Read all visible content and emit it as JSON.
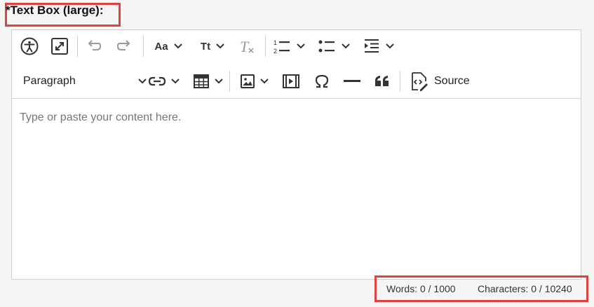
{
  "field": {
    "label": "*Text Box (large):"
  },
  "toolbar": {
    "row1": [
      {
        "name": "accessibility-icon"
      },
      {
        "name": "fullscreen-icon"
      },
      {
        "name": "undo-icon"
      },
      {
        "name": "redo-icon"
      },
      {
        "name": "font-family-icon",
        "label": "Aa"
      },
      {
        "name": "font-size-icon",
        "label": "Tt"
      },
      {
        "name": "remove-format-icon",
        "label": "T"
      },
      {
        "name": "numbered-list-icon"
      },
      {
        "name": "bulleted-list-icon"
      },
      {
        "name": "indent-icon"
      }
    ],
    "paragraph_label": "Paragraph",
    "source_label": "Source"
  },
  "editor": {
    "placeholder": "Type or paste your content here."
  },
  "counters": {
    "words": "Words: 0 / 1000",
    "characters": "Characters: 0 / 10240"
  },
  "colors": {
    "highlight": "#e04242",
    "icon": "#333333",
    "icon_disabled": "#9a9a9a"
  }
}
